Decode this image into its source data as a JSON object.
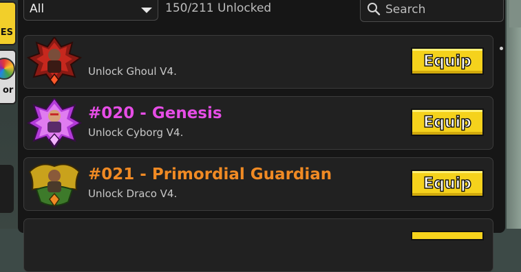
{
  "filter": {
    "selected": "All"
  },
  "unlocked_text": "150/211 Unlocked",
  "search": {
    "placeholder": "Search"
  },
  "side_tabs": {
    "titles_label": "ES",
    "color_label": "or"
  },
  "equip_label": "Equip",
  "titles": [
    {
      "title": "",
      "description": "Unlock Ghoul V4.",
      "title_color": "#ffffff"
    },
    {
      "title": "#020 - Genesis",
      "description": "Unlock Cyborg V4.",
      "title_color": "#e64de6"
    },
    {
      "title": "#021 - Primordial Guardian",
      "description": "Unlock Draco V4.",
      "title_color": "#f08a24"
    }
  ],
  "colors": {
    "equip_button": "#f5d21c",
    "panel": "#161616",
    "row": "#212121"
  }
}
